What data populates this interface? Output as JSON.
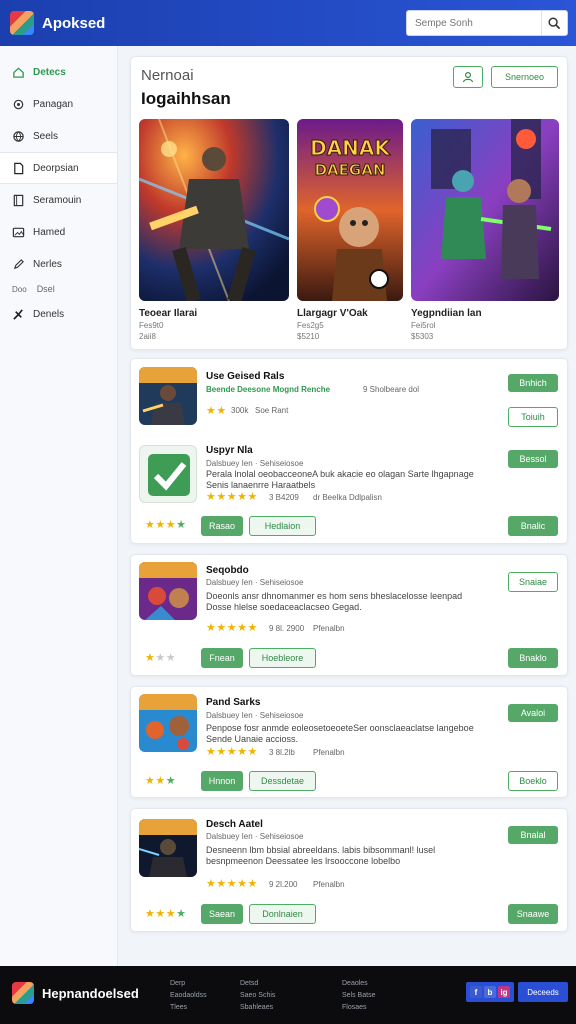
{
  "header": {
    "app_title": "Apoksed",
    "search_placeholder": "Sempe Sonh",
    "logo_icon": "app-logo",
    "search_icon": "search-icon"
  },
  "sidebar": {
    "items": [
      {
        "label": "Detecs",
        "icon": "home-icon",
        "active": true
      },
      {
        "label": "Panagan",
        "icon": "gear-icon"
      },
      {
        "label": "Seels",
        "icon": "globe-icon"
      },
      {
        "label": "Deorpsian",
        "icon": "document-icon",
        "selected": true
      },
      {
        "label": "Seramouin",
        "icon": "book-icon"
      },
      {
        "label": "Hamed",
        "icon": "image-icon"
      },
      {
        "label": "Nerles",
        "icon": "pen-icon"
      }
    ],
    "section": {
      "label": "Doo",
      "tag": "Dsel"
    },
    "extra_item": {
      "label": "Denels",
      "icon": "tools-icon"
    }
  },
  "featured": {
    "subtitle": "Nernoai",
    "title": "Iogaihhsan",
    "icon_button": "user-icon",
    "button_label": "Snernoeo",
    "games": [
      {
        "name": "Teoear Ilarai",
        "meta1": "Fes9t0",
        "meta2": "2aii8"
      },
      {
        "name": "Llargagr V'Oak",
        "meta1": "Fes2g5",
        "meta2": "$5210"
      },
      {
        "name": "Yegpndiian lan",
        "meta1": "Fei5rol",
        "meta2": "$5303"
      }
    ],
    "poster_text": "DANAK DAEGAN"
  },
  "apps": [
    {
      "name": "Use Geised Rals",
      "sub": "Beende Deesone Mognd Renche",
      "sub2": "9 Sholbeare dol",
      "desc": "",
      "stars": 2,
      "rating": "300k",
      "rating_label": "Soe Rant",
      "side_btn_1": "Bnhich",
      "side_btn_2": "Toiuih",
      "icon": "warrior-game-icon"
    },
    {
      "name": "Uspyr Nla",
      "sub": "Dalsbuey Ien · Sehiseiosoe",
      "desc": "Perala lnolal oeobacceoneA buk akacie eo olagan Sarte lhgapnage Senis lanaenrre Haraatbels",
      "stars": 5,
      "rating": "3 B4209",
      "rating_label": "dr Beelka Ddlpalisn",
      "side_btn_1": "Bessol",
      "bottom_stars": 4,
      "bottom_btn_1": "Rasao",
      "bottom_btn_2": "Hedlaion",
      "bottom_right_btn": "Bnalic",
      "icon": "checkmark-app-icon"
    },
    {
      "name": "Seqobdo",
      "sub": "Dalsbuey Ien · Sehiseiosoe",
      "desc": "Doeonls ansr dhnomanmer es hom sens bheslacelosse leenpad Dosse hlelse soedaceaclacseo Gegad.",
      "stars": 5,
      "rating": "9 8l. 2900",
      "rating_label": "Pfenalbn",
      "side_btn_1": "Snaiae",
      "bottom_stars": 1,
      "bottom_btn_1": "Fnean",
      "bottom_btn_2": "Hoebleore",
      "bottom_right_btn": "Bnaklo",
      "icon": "arcade-heroes-icon"
    },
    {
      "name": "Pand Sarks",
      "sub": "Dalsbuey Ien · Sehiseiosoe",
      "desc": "Penpose fosr anmde eoleosetoeoeteSer oonsclaeaclatse langeboe Sende Uanaie accioss.",
      "stars": 5,
      "rating": "3 8l.2lb",
      "rating_label": "Pfenalbn",
      "side_btn_1": "Avaloi",
      "bottom_stars": 3,
      "bottom_btn_1": "Hnnon",
      "bottom_btn_2": "Dessdetae",
      "bottom_right_btn": "Boeklo",
      "icon": "arena-brawl-icon"
    },
    {
      "name": "Desch Aatel",
      "sub": "Dalsbuey Ien · Sehiseiosoe",
      "desc": "Desneenn lbm bbsial abreeldans. labis bibsommanl! lusel besnpmeenon Deessatee les lrsooccone lobelbo",
      "stars": 5,
      "rating": "9 2l.200",
      "rating_label": "Pfenalbn",
      "side_btn_1": "Bnalal",
      "bottom_stars": 4,
      "bottom_btn_1": "Saean",
      "bottom_btn_2": "Donlnaien",
      "bottom_right_btn": "Snaawe",
      "icon": "dark-hunter-icon"
    }
  ],
  "footer": {
    "title": "Hepnandoelsed",
    "col1": [
      "Derp",
      "Eaodaoldss",
      "Tlees"
    ],
    "col2": [
      "Detsd",
      "Saeo Schis",
      "Sbahleaes"
    ],
    "col3": [
      "Deaoles",
      "Sels Batse",
      "Flosaes"
    ],
    "social": [
      "f",
      "b",
      "ig"
    ],
    "button_label": "Deceeds"
  },
  "colors": {
    "header_blue": "#1f45c0",
    "accent_green": "#4cae62",
    "footer_bg": "#0c0c0e",
    "star_yellow": "#f0b400"
  }
}
